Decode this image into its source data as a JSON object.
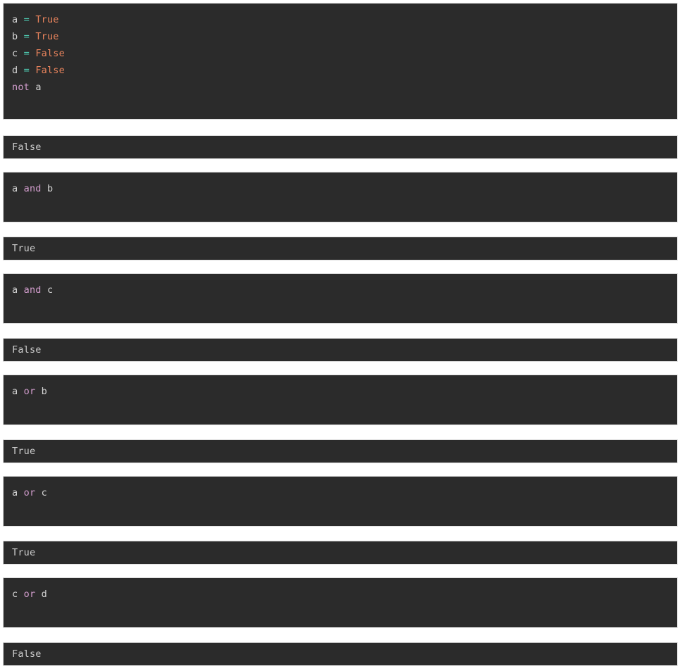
{
  "theme": {
    "page_background": "#ffffff",
    "cell_background": "#2b2b2b",
    "cell_border": "#e0e0e0",
    "variable_color": "#d4d4d4",
    "operator_color": "#4ec9b0",
    "literal_color": "#e8835c",
    "keyword_color": "#d29dcd",
    "output_text_color": "#cdcdcd"
  },
  "notebook": {
    "language": "python",
    "cells": [
      {
        "type": "code",
        "name": "cell-assignments-and-not",
        "lines": [
          {
            "tokens": [
              {
                "t": "a",
                "c": "name"
              },
              {
                "t": " ",
                "c": "plain"
              },
              {
                "t": "=",
                "c": "op"
              },
              {
                "t": " ",
                "c": "plain"
              },
              {
                "t": "True",
                "c": "lit"
              }
            ]
          },
          {
            "tokens": [
              {
                "t": "b",
                "c": "name"
              },
              {
                "t": " ",
                "c": "plain"
              },
              {
                "t": "=",
                "c": "op"
              },
              {
                "t": " ",
                "c": "plain"
              },
              {
                "t": "True",
                "c": "lit"
              }
            ]
          },
          {
            "tokens": [
              {
                "t": "c",
                "c": "name"
              },
              {
                "t": " ",
                "c": "plain"
              },
              {
                "t": "=",
                "c": "op"
              },
              {
                "t": " ",
                "c": "plain"
              },
              {
                "t": "False",
                "c": "lit"
              }
            ]
          },
          {
            "tokens": [
              {
                "t": "d",
                "c": "name"
              },
              {
                "t": " ",
                "c": "plain"
              },
              {
                "t": "=",
                "c": "op"
              },
              {
                "t": " ",
                "c": "plain"
              },
              {
                "t": "False",
                "c": "lit"
              }
            ]
          },
          {
            "tokens": [
              {
                "t": "not",
                "c": "kw"
              },
              {
                "t": " ",
                "c": "plain"
              },
              {
                "t": "a",
                "c": "name"
              }
            ]
          }
        ],
        "trailing_blank_lines": 1
      },
      {
        "type": "output",
        "name": "output-not-a",
        "text": "False"
      },
      {
        "type": "code",
        "name": "cell-a-and-b",
        "lines": [
          {
            "tokens": [
              {
                "t": "a",
                "c": "name"
              },
              {
                "t": " ",
                "c": "plain"
              },
              {
                "t": "and",
                "c": "kw"
              },
              {
                "t": " ",
                "c": "plain"
              },
              {
                "t": "b",
                "c": "name"
              }
            ]
          }
        ],
        "trailing_blank_lines": 1
      },
      {
        "type": "output",
        "name": "output-a-and-b",
        "text": "True"
      },
      {
        "type": "code",
        "name": "cell-a-and-c",
        "lines": [
          {
            "tokens": [
              {
                "t": "a",
                "c": "name"
              },
              {
                "t": " ",
                "c": "plain"
              },
              {
                "t": "and",
                "c": "kw"
              },
              {
                "t": " ",
                "c": "plain"
              },
              {
                "t": "c",
                "c": "name"
              }
            ]
          }
        ],
        "trailing_blank_lines": 1
      },
      {
        "type": "output",
        "name": "output-a-and-c",
        "text": "False"
      },
      {
        "type": "code",
        "name": "cell-a-or-b",
        "lines": [
          {
            "tokens": [
              {
                "t": "a",
                "c": "name"
              },
              {
                "t": " ",
                "c": "plain"
              },
              {
                "t": "or",
                "c": "kw"
              },
              {
                "t": " ",
                "c": "plain"
              },
              {
                "t": "b",
                "c": "name"
              }
            ]
          }
        ],
        "trailing_blank_lines": 1
      },
      {
        "type": "output",
        "name": "output-a-or-b",
        "text": "True"
      },
      {
        "type": "code",
        "name": "cell-a-or-c",
        "lines": [
          {
            "tokens": [
              {
                "t": "a",
                "c": "name"
              },
              {
                "t": " ",
                "c": "plain"
              },
              {
                "t": "or",
                "c": "kw"
              },
              {
                "t": " ",
                "c": "plain"
              },
              {
                "t": "c",
                "c": "name"
              }
            ]
          }
        ],
        "trailing_blank_lines": 1
      },
      {
        "type": "output",
        "name": "output-a-or-c",
        "text": "True"
      },
      {
        "type": "code",
        "name": "cell-c-or-d",
        "lines": [
          {
            "tokens": [
              {
                "t": "c",
                "c": "name"
              },
              {
                "t": " ",
                "c": "plain"
              },
              {
                "t": "or",
                "c": "kw"
              },
              {
                "t": " ",
                "c": "plain"
              },
              {
                "t": "d",
                "c": "name"
              }
            ]
          }
        ],
        "trailing_blank_lines": 1
      },
      {
        "type": "output",
        "name": "output-c-or-d",
        "text": "False"
      }
    ]
  }
}
